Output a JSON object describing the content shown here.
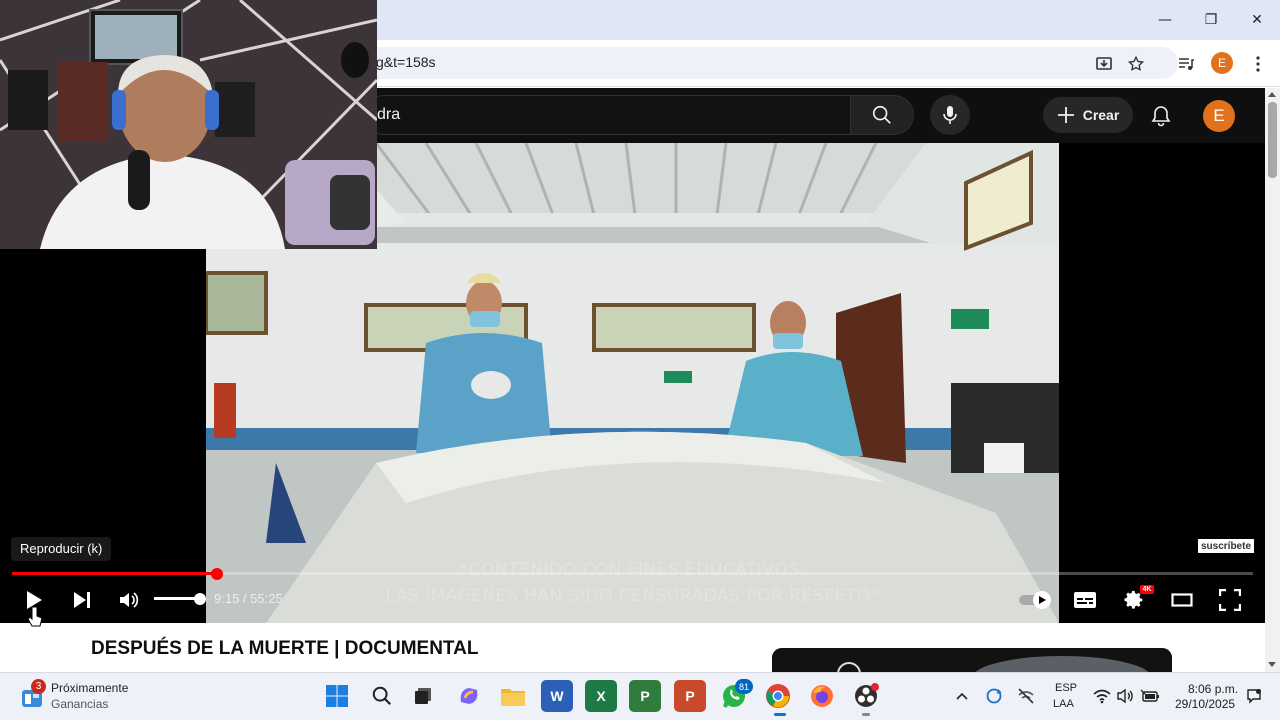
{
  "browser": {
    "url_fragment": "g&t=158s",
    "profile_initial": "E",
    "window_controls": {
      "minimize": "—",
      "restore": "❐",
      "close": "✕"
    }
  },
  "youtube_header": {
    "search_value": "dra",
    "create_label": "Crear",
    "avatar_initial": "E"
  },
  "player": {
    "tooltip": "Reproducir (k)",
    "current_time": "9:15",
    "duration": "55:25",
    "time_display": "9:15 / 55:25",
    "progress_fraction": 0.1652,
    "volume_fraction": 1.0,
    "subtitles": {
      "line1": "*CONTENIDO CON FINES EDUCATIVOS.",
      "line2": "LAS IMAGENES HAN SIDO CENSURADAS POR RESPETO*"
    },
    "watermark": "suscríbete",
    "quality_badge": "4K",
    "accent_color": "#ff0000"
  },
  "video": {
    "title": "DESPUÉS DE LA MUERTE | DOCUMENTAL"
  },
  "taskbar": {
    "widget": {
      "title": "Próximamente",
      "subtitle": "Ganancias",
      "badge": "3"
    },
    "apps": [
      {
        "name": "windows-start",
        "label": ""
      },
      {
        "name": "search",
        "label": ""
      },
      {
        "name": "task-view",
        "label": ""
      },
      {
        "name": "copilot",
        "label": ""
      },
      {
        "name": "file-explorer",
        "label": ""
      },
      {
        "name": "word",
        "label": "W"
      },
      {
        "name": "excel",
        "label": "X"
      },
      {
        "name": "project",
        "label": "P"
      },
      {
        "name": "powerpoint",
        "label": "P"
      },
      {
        "name": "whatsapp",
        "label": ""
      },
      {
        "name": "chrome",
        "label": ""
      },
      {
        "name": "firefox",
        "label": ""
      },
      {
        "name": "obs",
        "label": ""
      }
    ],
    "whatsapp_badge": "81",
    "language_line1": "ESP",
    "language_line2": "LAA",
    "time": "8:06 p.m.",
    "date": "29/10/2025"
  }
}
